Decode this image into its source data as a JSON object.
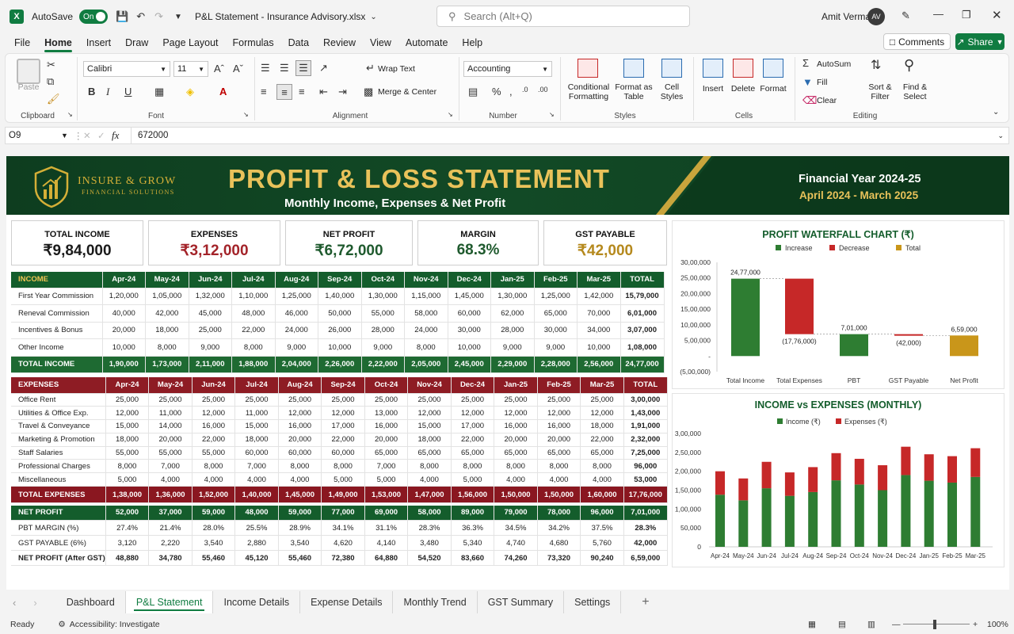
{
  "titlebar": {
    "autosave_label": "AutoSave",
    "autosave_state": "On",
    "filename": "P&L Statement - Insurance Advisory.xlsx",
    "search_placeholder": "Search (Alt+Q)",
    "user_name": "Amit Verma",
    "user_initials": "AV"
  },
  "menu": {
    "items": [
      "File",
      "Home",
      "Insert",
      "Draw",
      "Page Layout",
      "Formulas",
      "Data",
      "Review",
      "View",
      "Automate",
      "Help"
    ],
    "active": "Home",
    "comments_label": "Comments",
    "share_label": "Share"
  },
  "ribbon": {
    "clipboard": {
      "paste": "Paste",
      "label": "Clipboard"
    },
    "font": {
      "name": "Calibri",
      "size": "11",
      "label": "Font"
    },
    "alignment": {
      "wrap": "Wrap Text",
      "merge": "Merge & Center",
      "label": "Alignment"
    },
    "number": {
      "format": "Accounting",
      "label": "Number"
    },
    "styles": {
      "conditional": "Conditional\nFormatting",
      "format_table": "Format as\nTable",
      "cell_styles": "Cell\nStyles",
      "label": "Styles"
    },
    "cells": {
      "insert": "Insert",
      "delete": "Delete",
      "format": "Format",
      "label": "Cells"
    },
    "editing": {
      "autosum": "AutoSum",
      "fill": "Fill",
      "clear": "Clear",
      "sort": "Sort &\nFilter",
      "find": "Find &\nSelect",
      "label": "Editing"
    }
  },
  "formula_bar": {
    "cell_ref": "O9",
    "fx": "fx",
    "value": "672000"
  },
  "banner": {
    "company": "INSURE & GROW",
    "company_sub": "FINANCIAL SOLUTIONS",
    "title": "PROFIT & LOSS STATEMENT",
    "subtitle": "Monthly Income, Expenses & Net Profit",
    "fy": "Financial Year 2024-25",
    "period": "April 2024 - March 2025"
  },
  "kpis": [
    {
      "label": "TOTAL INCOME",
      "value": "₹9,84,000",
      "color": "#1a1a1a"
    },
    {
      "label": "EXPENSES",
      "value": "₹3,12,000",
      "color": "#a32329"
    },
    {
      "label": "NET PROFIT",
      "value": "₹6,72,000",
      "color": "#1f5a2e"
    },
    {
      "label": "MARGIN",
      "value": "68.3%",
      "color": "#1f5a2e"
    },
    {
      "label": "GST PAYABLE",
      "value": "₹42,000",
      "color": "#b5891d"
    }
  ],
  "months": [
    "Apr-24",
    "May-24",
    "Jun-24",
    "Jul-24",
    "Aug-24",
    "Sep-24",
    "Oct-24",
    "Nov-24",
    "Dec-24",
    "Jan-25",
    "Feb-25",
    "Mar-25"
  ],
  "total_label": "TOTAL",
  "income": {
    "header": "INCOME",
    "rows": [
      {
        "name": "First Year Commission",
        "values": [
          "1,20,000",
          "1,05,000",
          "1,32,000",
          "1,10,000",
          "1,25,000",
          "1,40,000",
          "1,30,000",
          "1,15,000",
          "1,45,000",
          "1,30,000",
          "1,25,000",
          "1,42,000"
        ],
        "total": "15,79,000"
      },
      {
        "name": "Reneval Commission",
        "values": [
          "40,000",
          "42,000",
          "45,000",
          "48,000",
          "46,000",
          "50,000",
          "55,000",
          "58,000",
          "60,000",
          "62,000",
          "65,000",
          "70,000"
        ],
        "total": "6,01,000"
      },
      {
        "name": "Incentives & Bonus",
        "values": [
          "20,000",
          "18,000",
          "25,000",
          "22,000",
          "24,000",
          "26,000",
          "28,000",
          "24,000",
          "30,000",
          "28,000",
          "30,000",
          "34,000"
        ],
        "total": "3,07,000"
      },
      {
        "name": "Other Income",
        "values": [
          "10,000",
          "8,000",
          "9,000",
          "8,000",
          "9,000",
          "10,000",
          "9,000",
          "8,000",
          "10,000",
          "9,000",
          "9,000",
          "10,000"
        ],
        "total": "1,08,000"
      }
    ],
    "total_row": {
      "name": "TOTAL INCOME",
      "values": [
        "1,90,000",
        "1,73,000",
        "2,11,000",
        "1,88,000",
        "2,04,000",
        "2,26,000",
        "2,22,000",
        "2,05,000",
        "2,45,000",
        "2,29,000",
        "2,28,000",
        "2,56,000"
      ],
      "total": "24,77,000"
    }
  },
  "expenses": {
    "header": "EXPENSES",
    "rows": [
      {
        "name": "Office Rent",
        "values": [
          "25,000",
          "25,000",
          "25,000",
          "25,000",
          "25,000",
          "25,000",
          "25,000",
          "25,000",
          "25,000",
          "25,000",
          "25,000",
          "25,000"
        ],
        "total": "3,00,000"
      },
      {
        "name": "Utilities & Office Exp.",
        "values": [
          "12,000",
          "11,000",
          "12,000",
          "11,000",
          "12,000",
          "12,000",
          "13,000",
          "12,000",
          "12,000",
          "12,000",
          "12,000",
          "12,000"
        ],
        "total": "1,43,000"
      },
      {
        "name": "Travel & Conveyance",
        "values": [
          "15,000",
          "14,000",
          "16,000",
          "15,000",
          "16,000",
          "17,000",
          "16,000",
          "15,000",
          "17,000",
          "16,000",
          "16,000",
          "18,000"
        ],
        "total": "1,91,000"
      },
      {
        "name": "Marketing & Promotion",
        "values": [
          "18,000",
          "20,000",
          "22,000",
          "18,000",
          "20,000",
          "22,000",
          "20,000",
          "18,000",
          "22,000",
          "20,000",
          "20,000",
          "22,000"
        ],
        "total": "2,32,000"
      },
      {
        "name": "Staff Salaries",
        "values": [
          "55,000",
          "55,000",
          "55,000",
          "60,000",
          "60,000",
          "60,000",
          "65,000",
          "65,000",
          "65,000",
          "65,000",
          "65,000",
          "65,000"
        ],
        "total": "7,25,000"
      },
      {
        "name": "Professional Charges",
        "values": [
          "8,000",
          "7,000",
          "8,000",
          "7,000",
          "8,000",
          "8,000",
          "7,000",
          "8,000",
          "8,000",
          "8,000",
          "8,000",
          "8,000"
        ],
        "total": "96,000"
      },
      {
        "name": "Miscellaneous",
        "values": [
          "5,000",
          "4,000",
          "4,000",
          "4,000",
          "4,000",
          "5,000",
          "5,000",
          "4,000",
          "5,000",
          "4,000",
          "4,000",
          "4,000"
        ],
        "total": "53,000"
      }
    ],
    "total_row": {
      "name": "TOTAL EXPENSES",
      "values": [
        "1,38,000",
        "1,36,000",
        "1,52,000",
        "1,40,000",
        "1,45,000",
        "1,49,000",
        "1,53,000",
        "1,47,000",
        "1,56,000",
        "1,50,000",
        "1,50,000",
        "1,60,000"
      ],
      "total": "17,76,000"
    }
  },
  "profit": {
    "net_profit": {
      "name": "NET PROFIT",
      "values": [
        "52,000",
        "37,000",
        "59,000",
        "48,000",
        "59,000",
        "77,000",
        "69,000",
        "58,000",
        "89,000",
        "79,000",
        "78,000",
        "96,000"
      ],
      "total": "7,01,000"
    },
    "margin": {
      "name": "PBT MARGIN (%)",
      "values": [
        "27.4%",
        "21.4%",
        "28.0%",
        "25.5%",
        "28.9%",
        "34.1%",
        "31.1%",
        "28.3%",
        "36.3%",
        "34.5%",
        "34.2%",
        "37.5%"
      ],
      "total": "28.3%"
    },
    "gst": {
      "name": "GST PAYABLE (6%)",
      "values": [
        "3,120",
        "2,220",
        "3,540",
        "2,880",
        "3,540",
        "4,620",
        "4,140",
        "3,480",
        "5,340",
        "4,740",
        "4,680",
        "5,760"
      ],
      "total": "42,000"
    },
    "after_gst": {
      "name": "NET PROFIT (After GST)",
      "values": [
        "48,880",
        "34,780",
        "55,460",
        "45,120",
        "55,460",
        "72,380",
        "64,880",
        "54,520",
        "83,660",
        "74,260",
        "73,320",
        "90,240"
      ],
      "total": "6,59,000"
    }
  },
  "chart_data": [
    {
      "type": "bar",
      "subtype": "waterfall",
      "title": "PROFIT WATERFALL CHART (₹)",
      "legend": [
        "Increase",
        "Decrease",
        "Total"
      ],
      "legend_position": "top",
      "categories": [
        "Total Income",
        "Total Expenses",
        "PBT",
        "GST Payable",
        "Net Profit"
      ],
      "values": [
        2477000,
        -1776000,
        701000,
        -42000,
        659000
      ],
      "kinds": [
        "increase",
        "decrease",
        "increase",
        "decrease",
        "total"
      ],
      "data_labels": [
        "24,77,000",
        "(17,76,000)",
        "7,01,000",
        "(42,000)",
        "6,59,000"
      ],
      "yticks": [
        "30,00,000",
        "25,00,000",
        "20,00,000",
        "15,00,000",
        "10,00,000",
        "5,00,000",
        "-",
        "(5,00,000)"
      ],
      "ylim": [
        -500000,
        3000000
      ],
      "colors": {
        "increase": "#2e7d32",
        "decrease": "#c62828",
        "total": "#c9961a"
      }
    },
    {
      "type": "bar",
      "subtype": "stacked",
      "title": "INCOME vs EXPENSES (MONTHLY)",
      "legend_position": "top",
      "categories": [
        "Apr-24",
        "May-24",
        "Jun-24",
        "Jul-24",
        "Aug-24",
        "Sep-24",
        "Oct-24",
        "Nov-24",
        "Dec-24",
        "Jan-25",
        "Feb-25",
        "Mar-25"
      ],
      "series": [
        {
          "name": "Income (₹)",
          "color": "#2e7d32",
          "values": [
            138000,
            123000,
            155000,
            135000,
            145000,
            176000,
            165000,
            150000,
            190000,
            175000,
            170000,
            185000
          ]
        },
        {
          "name": "Expenses (₹)",
          "color": "#c62828",
          "values": [
            62000,
            58000,
            70000,
            62000,
            66000,
            72000,
            68000,
            66000,
            75000,
            70000,
            70000,
            76000
          ]
        }
      ],
      "yticks": [
        "3,00,000",
        "2,50,000",
        "2,00,000",
        "1,50,000",
        "1,00,000",
        "50,000",
        "0"
      ],
      "ylim": [
        0,
        300000
      ]
    }
  ],
  "sheet_tabs": [
    "Dashboard",
    "P&L Statement",
    "Income Details",
    "Expense Details",
    "Monthly Trend",
    "GST Summary",
    "Settings"
  ],
  "active_tab": "P&L Statement",
  "status": {
    "ready": "Ready",
    "accessibility": "Accessibility: Investigate",
    "zoom": "100%"
  }
}
